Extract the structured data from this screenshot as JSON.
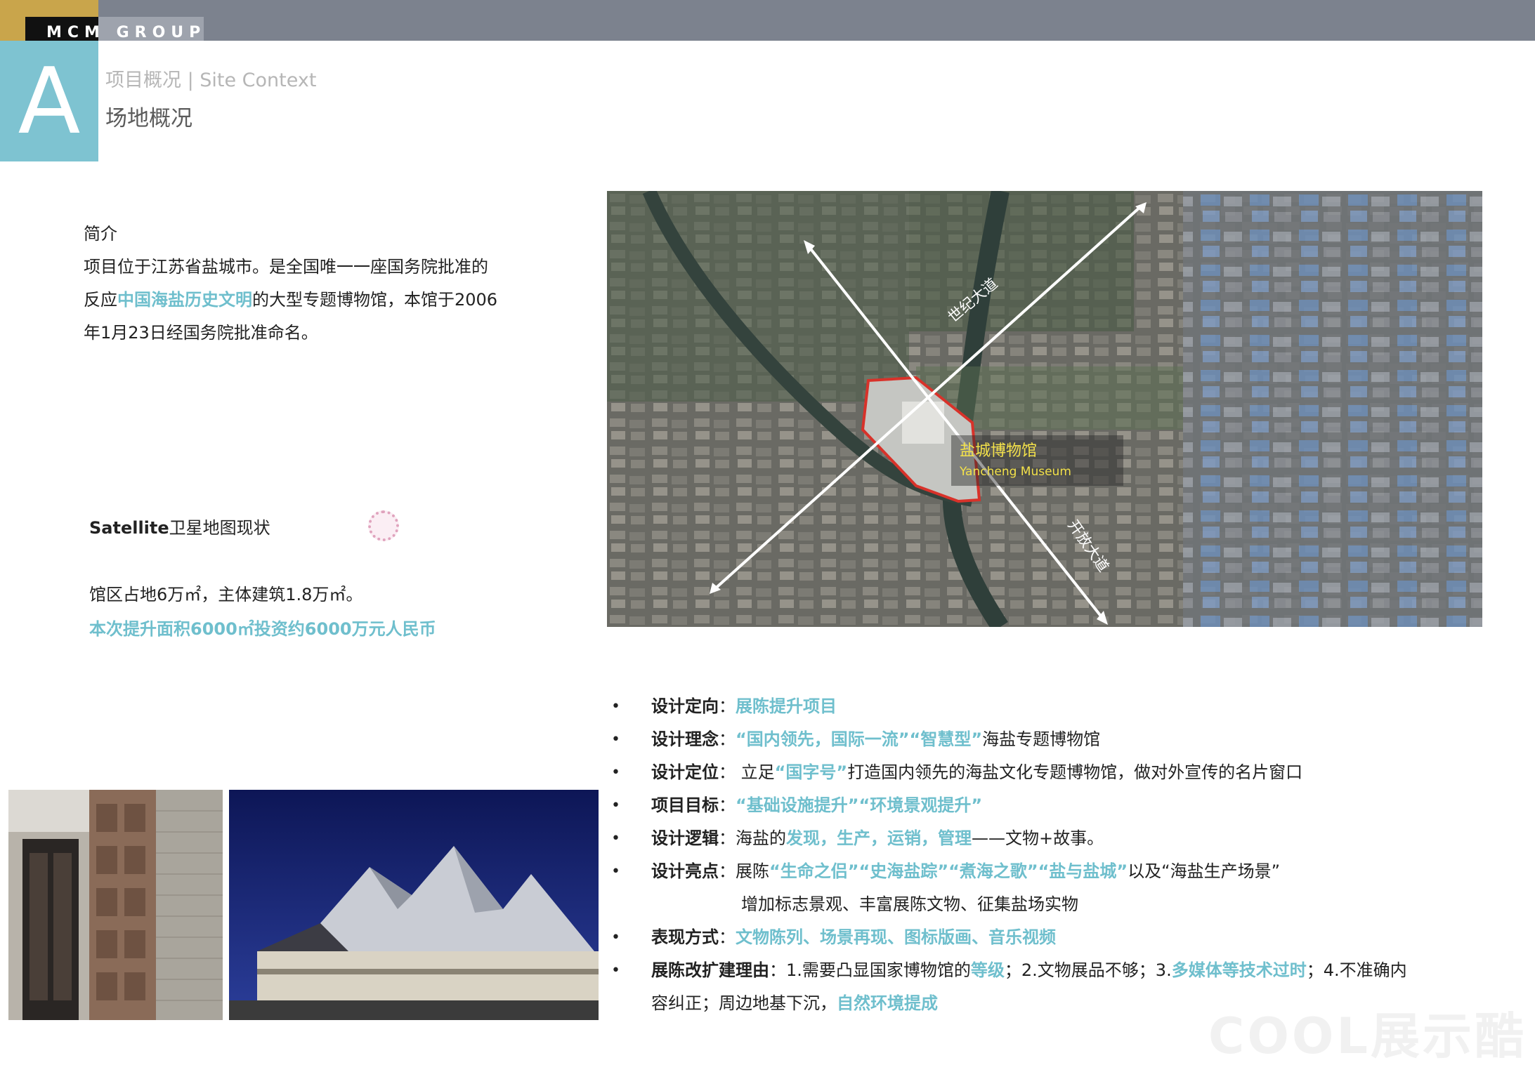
{
  "header": {
    "brand": "MCM GROUP",
    "section_letter": "A",
    "section_subtitle": "项目概况 | Site Context",
    "page_title": "场地概况"
  },
  "intro": {
    "heading": "简介",
    "line1": "项目位于江苏省盐城市。是全国唯一一座国务院批准的",
    "line2_pre": "反应",
    "line2_hl": "中国海盐历史文明",
    "line2_post": "的大型专题博物馆，本馆于2006",
    "line3": "年1月23日经国务院批准命名。"
  },
  "satellite": {
    "heading_bold": "Satellite",
    "heading_rest": "卫星地图现状",
    "area": "馆区占地6万㎡，主体建筑1.8万㎡。",
    "investment": "本次提升面积6000㎡投资约6000万元人民币"
  },
  "map": {
    "museum_cn": "盐城博物馆",
    "museum_en": "Yancheng Museum",
    "road1": "世纪大道",
    "road2": "开放大道"
  },
  "bullets": {
    "b1_label": "设计定向",
    "b1_hl": "展陈提升项目",
    "b2_label": "设计理念",
    "b2_hl": "“国内领先，国际一流”“智慧型”",
    "b2_post": "海盐专题博物馆",
    "b3_label": "设计定位",
    "b3_pre": "立足",
    "b3_hl": "“国字号”",
    "b3_post": "打造国内领先的海盐文化专题博物馆，做对外宣传的名片窗口",
    "b4_label": "项目目标",
    "b4_hl": "“基础设施提升”“环境景观提升”",
    "b5_label": "设计逻辑",
    "b5_pre": "海盐的",
    "b5_hl": "发现，生产，运销，管理",
    "b5_post": "——文物+故事。",
    "b6_label": "设计亮点",
    "b6_pre": "展陈",
    "b6_hl": "“生命之侣”“史海盐踪”“煮海之歌”“盐与盐城”",
    "b6_post": "以及“海盐生产场景”",
    "b6_line2": "增加标志景观、丰富展陈文物、征集盐场实物",
    "b7_label": "表现方式",
    "b7_hl": "文物陈列、场景再现、图标版画、音乐视频",
    "b8_label": "展陈改扩建理由",
    "b8_t1": "1.需要凸显国家博物馆的",
    "b8_h1": "等级",
    "b8_t2": "；2.文物展品不够；3.",
    "b8_h2": "多媒体等技术过时",
    "b8_t3": "；4.不准确内",
    "b8_t4": "容纠正；周边地基下沉，",
    "b8_h3": "自然环境提成"
  },
  "watermark": "COOL展示酷",
  "colors": {
    "accent": "#7ec3d1",
    "highlight_text": "#6fbfcd",
    "topbar": "#7c828e",
    "museum_outline": "#d8322a",
    "map_label": "#f3e14a"
  }
}
